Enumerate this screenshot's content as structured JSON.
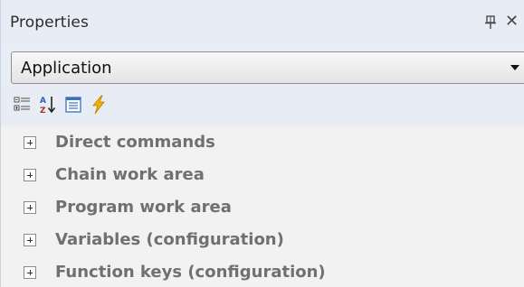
{
  "panel": {
    "title": "Properties",
    "pin_icon": "pin-icon",
    "close_label": "✕"
  },
  "dropdown": {
    "selected": "Application"
  },
  "toolbar": {
    "buttons": [
      {
        "name": "categorized-icon"
      },
      {
        "name": "alphabetical-icon"
      },
      {
        "name": "properties-icon"
      },
      {
        "name": "events-icon"
      }
    ]
  },
  "categories": [
    {
      "label": "Direct commands"
    },
    {
      "label": "Chain work area"
    },
    {
      "label": "Program work area"
    },
    {
      "label": "Variables (configuration)"
    },
    {
      "label": "Function keys (configuration)"
    }
  ],
  "colors": {
    "panel_bg": "#e9edf5",
    "list_bg": "#f2f2f2",
    "category_text": "#707070",
    "events_icon": "#f2b200"
  }
}
